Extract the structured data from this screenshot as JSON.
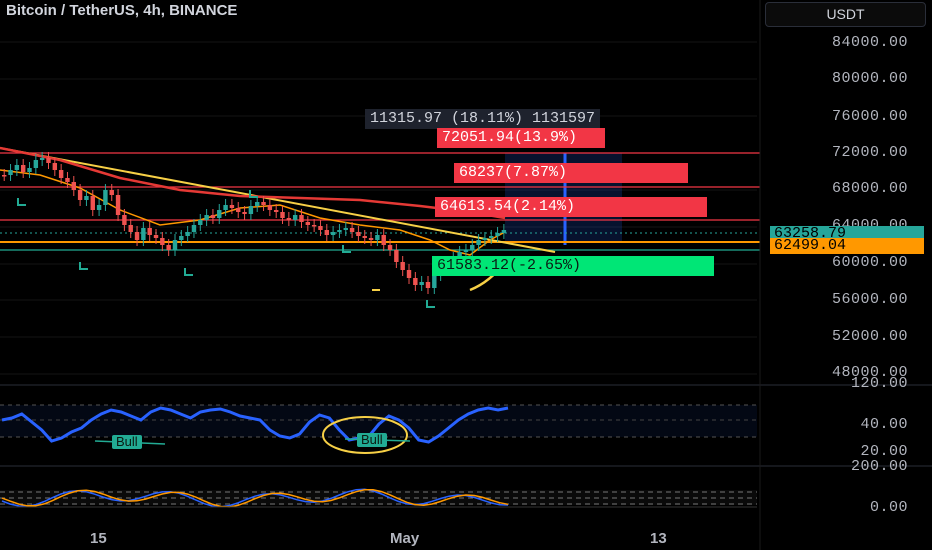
{
  "header": {
    "title": "Bitcoin / TetherUS, 4h, BINANCE",
    "currency_button": "USDT"
  },
  "price_axis": {
    "labels": [
      "84000.00",
      "80000.00",
      "76000.00",
      "72000.00",
      "68000.00",
      "64000.00",
      "60000.00",
      "56000.00",
      "52000.00",
      "48000.00"
    ],
    "current_price": "63258.79",
    "level_price": "62499.04"
  },
  "rsi_axis": {
    "labels": [
      "120.00",
      "40.00",
      "20.00"
    ]
  },
  "osc_axis": {
    "labels": [
      "200.00",
      "0.00"
    ]
  },
  "time_axis": {
    "labels": [
      "15",
      "May",
      "13"
    ]
  },
  "annotations": {
    "range_label": "11315.97 (18.11%) 1131597",
    "target3": "72051.94(13.9%)",
    "target2": "68237(7.87%)",
    "target1": "64613.54(2.14%)",
    "stop": "61583.12(-2.65%)",
    "bull1": "Bull",
    "bull2": "Bull"
  },
  "colors": {
    "background": "#000000",
    "up": "#26a69a",
    "down": "#ef5350",
    "target": "#f23645",
    "stop": "#22ab94",
    "trendline": "#f7d046",
    "rsi": "#2962ff",
    "level": "#ff9800"
  }
}
